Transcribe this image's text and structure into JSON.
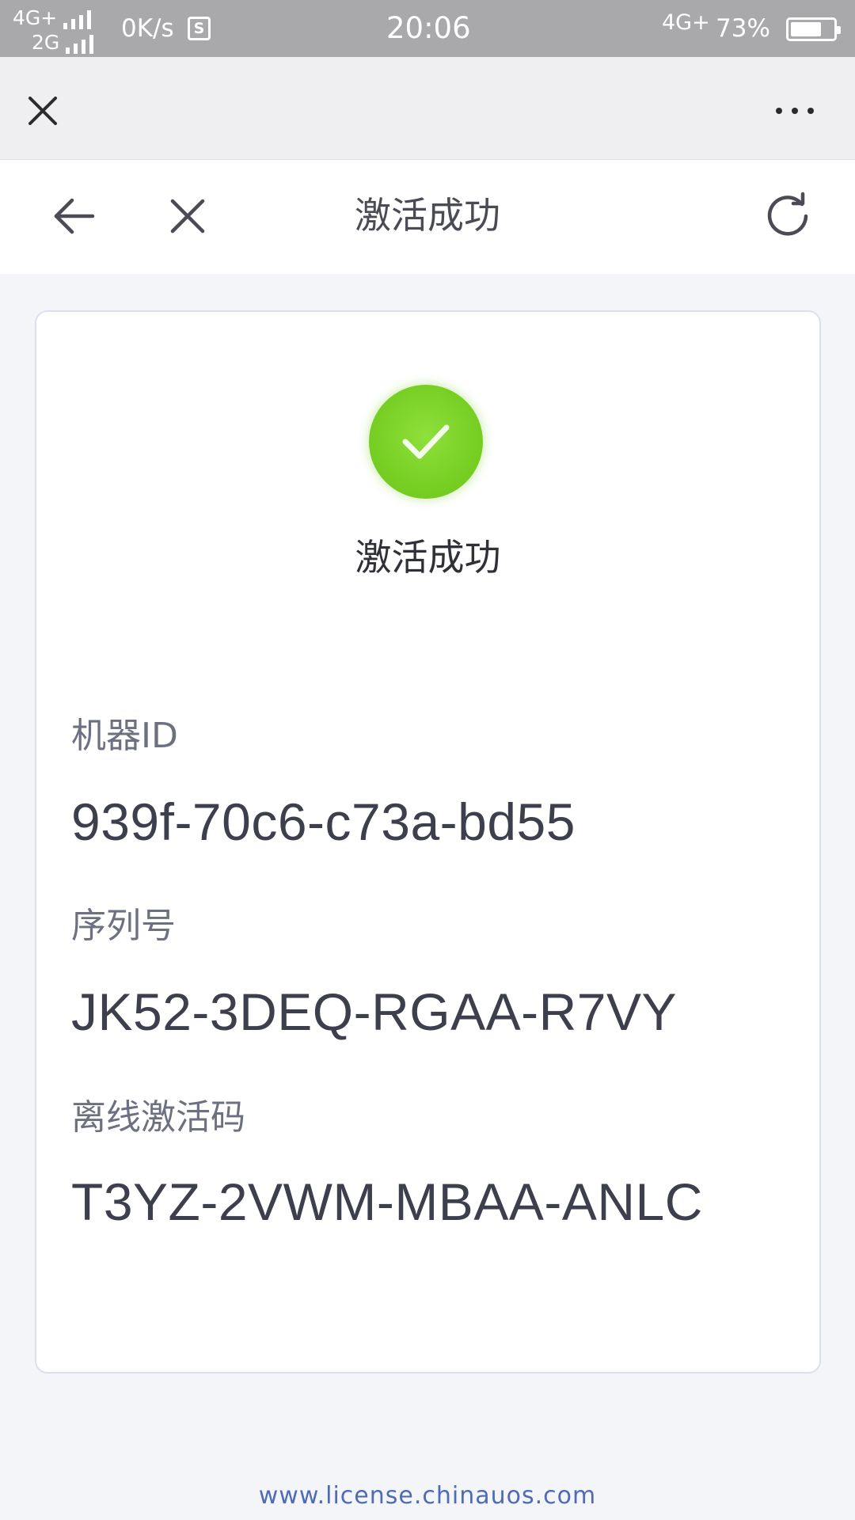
{
  "status_bar": {
    "network_top": "4G+",
    "network_bottom": "2G",
    "speed": "0K/s",
    "sim_icon_label": "S",
    "time": "20:06",
    "network_right": "4G+",
    "battery_percent": "73%",
    "battery_level": 0.73
  },
  "top_bar": {
    "close_icon": "close-icon",
    "more_icon": "more-icon"
  },
  "nav": {
    "title": "激活成功",
    "back_icon": "arrow-left-icon",
    "close_icon": "close-icon",
    "refresh_icon": "refresh-icon"
  },
  "card": {
    "success_icon": "check-circle-icon",
    "success_text": "激活成功",
    "fields": [
      {
        "label": "机器ID",
        "value": "939f-70c6-c73a-bd55"
      },
      {
        "label": "序列号",
        "value": "JK52-3DEQ-RGAA-R7VY"
      },
      {
        "label": "离线激活码",
        "value": "T3YZ-2VWM-MBAA-ANLC"
      }
    ]
  },
  "footer": {
    "link": "www.license.chinauos.com"
  },
  "colors": {
    "success_green": "#7ed12a",
    "page_bg": "#f3f5f9",
    "status_bar_bg": "#a9a9ab",
    "link_blue": "#4f6bb5"
  }
}
